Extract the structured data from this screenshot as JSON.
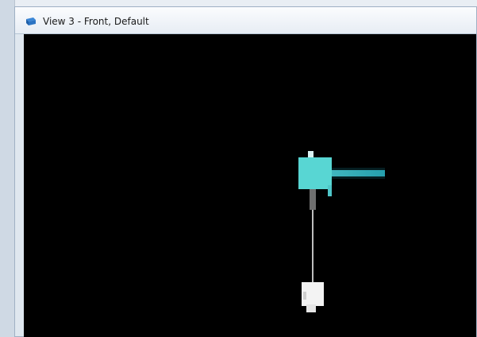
{
  "window": {
    "title": "View 3 - Front, Default",
    "icon": "view-window-icon"
  },
  "viewport": {
    "background_color": "#000000",
    "model_colors": {
      "cyan_body": "#54d4d1",
      "cyan_arm": "#3fb8c2",
      "white_part": "#f2f2f2",
      "gray_shaft": "#8a8a8a"
    }
  }
}
